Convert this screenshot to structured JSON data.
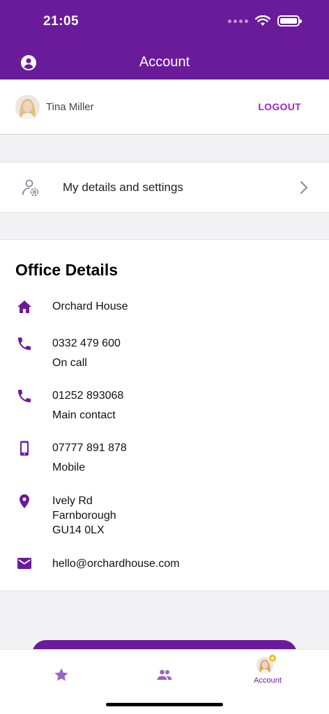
{
  "status_bar": {
    "time": "21:05"
  },
  "header": {
    "title": "Account",
    "account_icon": "account-circle-icon"
  },
  "user": {
    "name": "Tina Miller",
    "logout_label": "LOGOUT"
  },
  "settings": {
    "label": "My details and settings",
    "icon": "user-gear-icon"
  },
  "office": {
    "title": "Office Details",
    "name": "Orchard House",
    "phones": [
      {
        "number": "0332 479 600",
        "label": "On call",
        "icon": "phone-icon"
      },
      {
        "number": "01252 893068",
        "label": "Main contact",
        "icon": "phone-icon"
      },
      {
        "number": "07777 891 878",
        "label": "Mobile",
        "icon": "mobile-icon"
      }
    ],
    "address": [
      "Ively Rd",
      "Farnborough",
      "GU14 0LX"
    ],
    "email": "hello@orchardhouse.com"
  },
  "tabbar": {
    "tabs": [
      {
        "icon": "star-icon",
        "label": ""
      },
      {
        "icon": "people-icon",
        "label": ""
      },
      {
        "icon": "avatar-icon",
        "label": "Account"
      }
    ]
  },
  "colors": {
    "brand": "#6a1b9a",
    "accent": "#a223c8",
    "background": "#f2f2f4"
  }
}
